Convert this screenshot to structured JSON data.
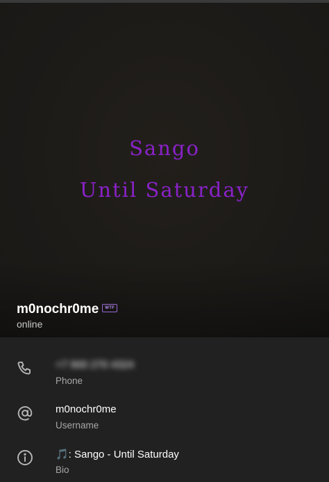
{
  "cover": {
    "line1": "Sango",
    "line2": "Until Saturday"
  },
  "profile": {
    "name": "m0nochr0me",
    "badge": "WTF",
    "status": "online"
  },
  "info": {
    "phone": {
      "value": "+7 900 270 4324",
      "label": "Phone",
      "icon": "phone-icon"
    },
    "username": {
      "value": "m0nochr0me",
      "label": "Username",
      "icon": "at-sign-icon"
    },
    "bio": {
      "value": "🎵: Sango - Until Saturday",
      "label": "Bio",
      "icon": "info-icon"
    }
  },
  "colors": {
    "accent_purple": "#8a22c9",
    "background": "#212121",
    "cover_bg": "#1d1b18"
  }
}
